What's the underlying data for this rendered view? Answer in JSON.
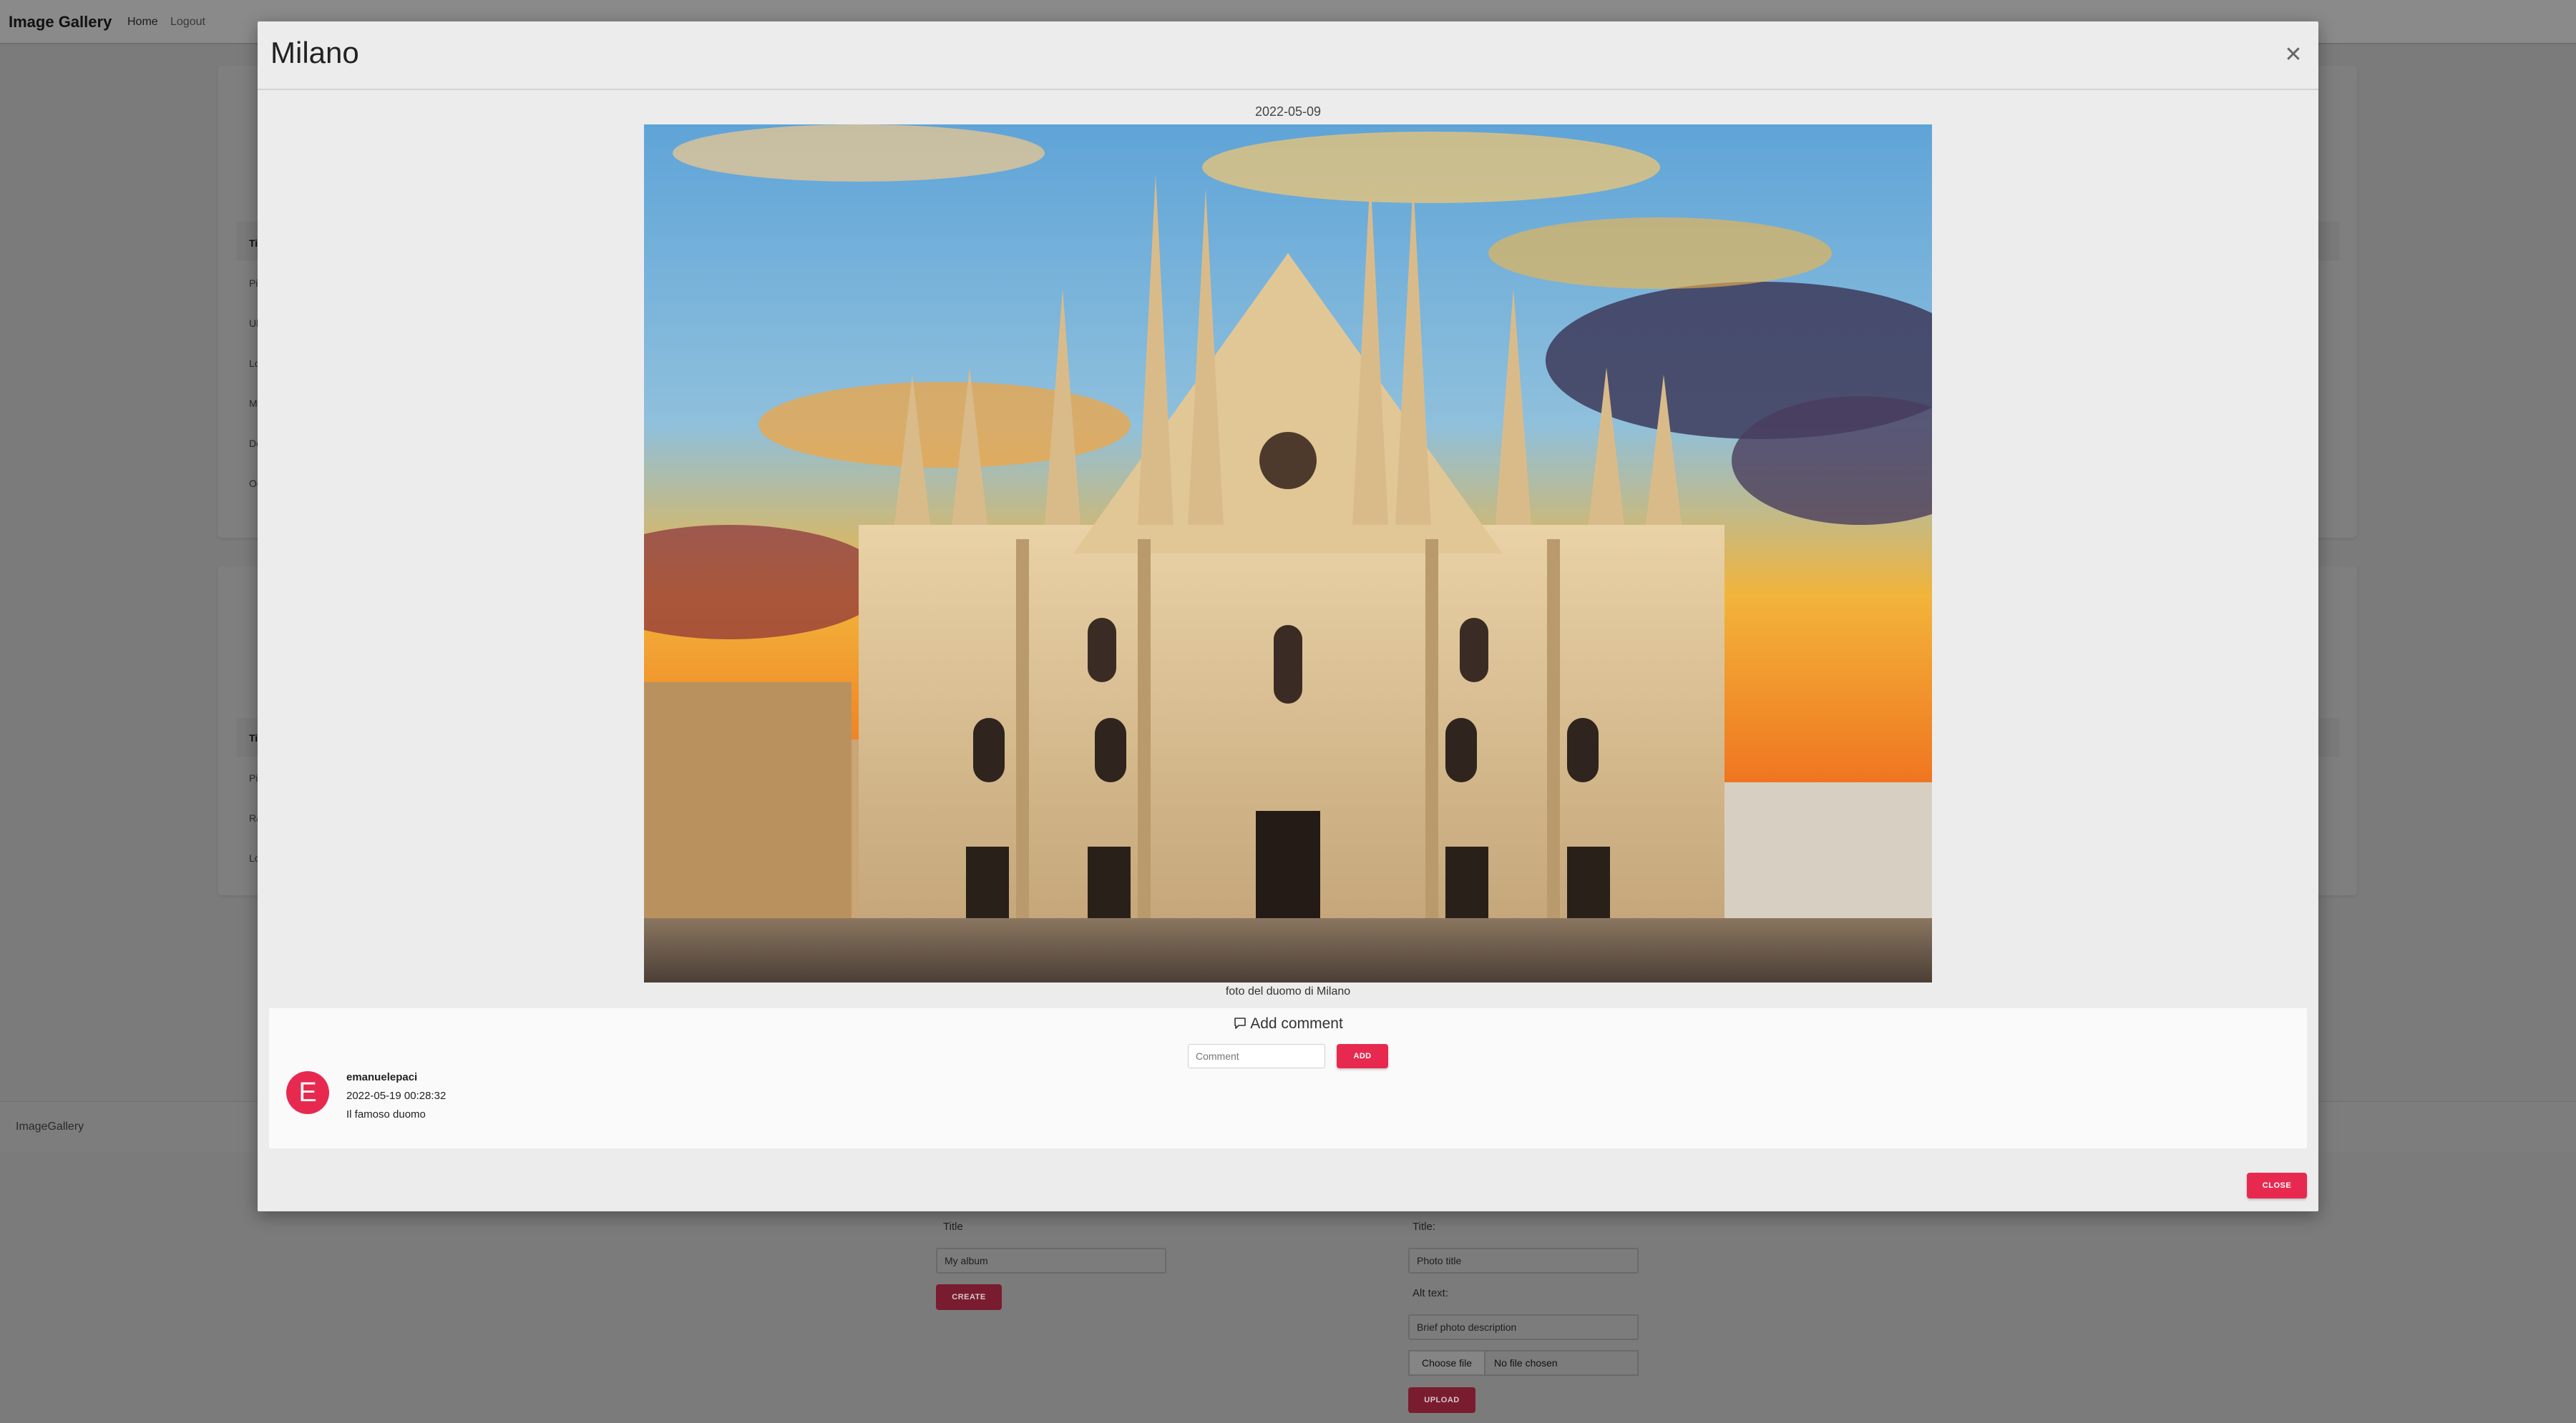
{
  "navbar": {
    "brand": "Image Gallery",
    "home": "Home",
    "logout": "Logout"
  },
  "background": {
    "table1_rows": [
      "Ti",
      "Pi",
      "Ul",
      "Lo",
      "M",
      "De",
      "Oc"
    ],
    "table2_rows": [
      "Ti",
      "Pi",
      "Ra",
      "Lo"
    ],
    "footer": "ImageGallery",
    "album_form": {
      "title_label": "Title",
      "title_placeholder": "My album",
      "create_button": "CREATE"
    },
    "upload_form": {
      "title_label": "Title:",
      "title_placeholder": "Photo title",
      "alt_label": "Alt text:",
      "alt_placeholder": "Brief photo description",
      "choose_file": "Choose file",
      "no_file": "No file chosen",
      "upload_button": "UPLOAD"
    }
  },
  "modal": {
    "title": "Milano",
    "close_icon": "close-icon",
    "photo_date": "2022-05-09",
    "photo_caption": "foto del duomo di Milano",
    "comments": {
      "heading": "Add comment",
      "heading_icon": "comment-icon",
      "input_placeholder": "Comment",
      "add_button": "ADD",
      "items": [
        {
          "avatar_letter": "E",
          "user": "emanuelepaci",
          "timestamp": "2022-05-19 00:28:32",
          "text": "Il famoso duomo"
        }
      ]
    },
    "close_button": "CLOSE"
  },
  "colors": {
    "accent": "#e8294f",
    "overlay_bg": "#7b7b7b",
    "modal_bg": "#ececec"
  }
}
